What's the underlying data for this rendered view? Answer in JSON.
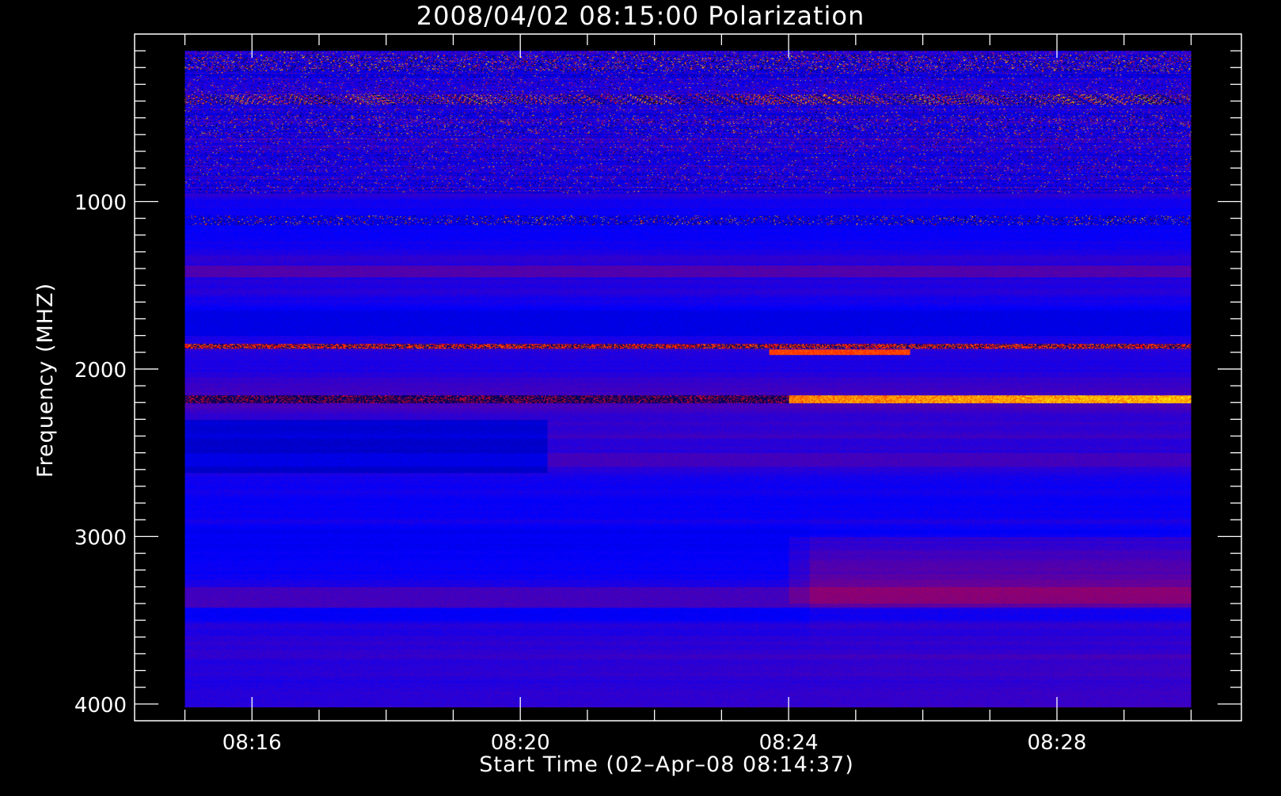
{
  "chart_data": {
    "type": "heatmap",
    "title": "2008/04/02 08:15:00 Polarization",
    "xlabel": "Start Time (02–Apr–08 08:14:37)",
    "ylabel": "Frequency (MHZ)",
    "x_axis": {
      "unit": "time",
      "range": [
        "08:14:15",
        "08:30:45"
      ],
      "data_range": [
        "08:15:00",
        "08:30:00"
      ],
      "ticks": [
        "08:16",
        "08:20",
        "08:24",
        "08:28"
      ]
    },
    "y_axis": {
      "unit": "MHz",
      "range": [
        0,
        4100
      ],
      "inverted": true,
      "data_range": [
        100,
        4020
      ],
      "ticks": [
        1000,
        2000,
        3000,
        4000
      ]
    },
    "colormap": [
      "#000000",
      "#0000ff",
      "#ff0000",
      "#ffff00"
    ],
    "background": "#000000",
    "foreground": "#ffffff"
  }
}
